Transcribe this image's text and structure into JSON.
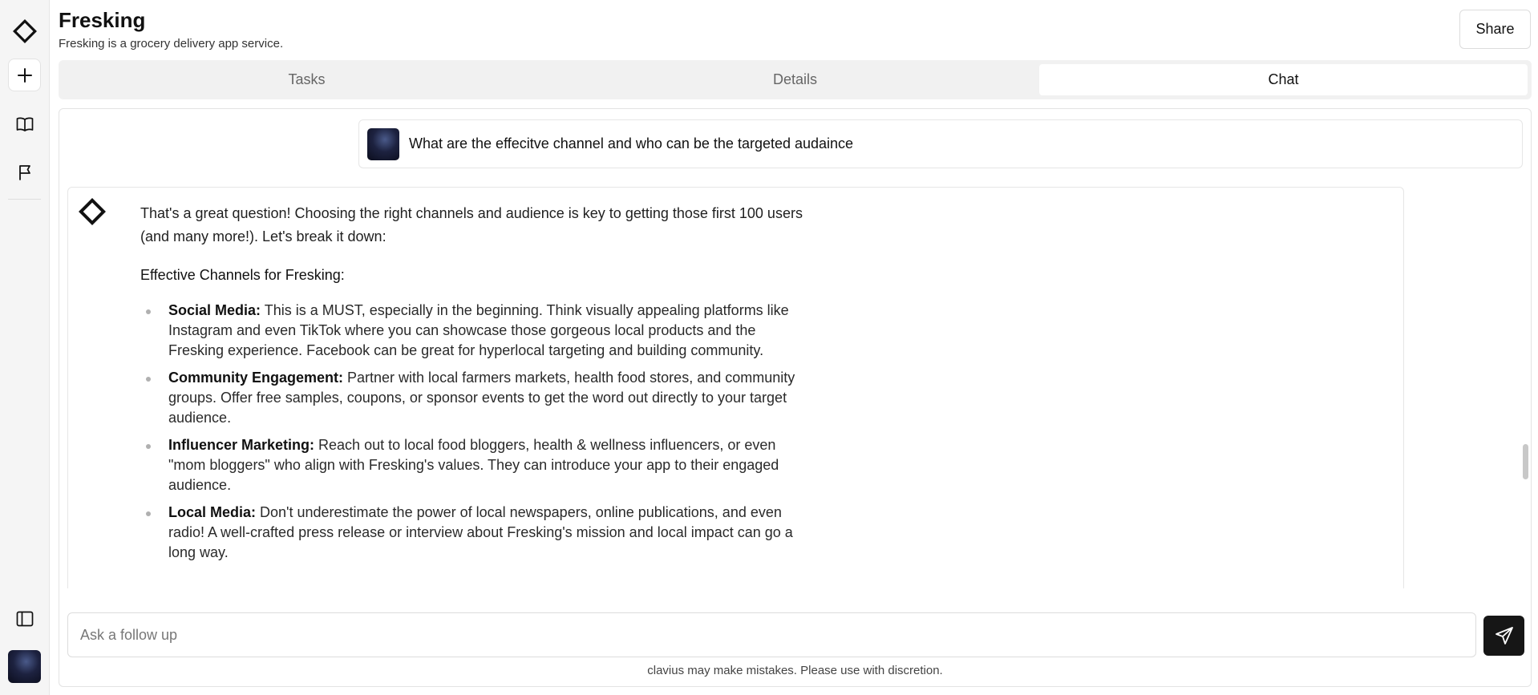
{
  "app": {
    "title": "Fresking",
    "subtitle": "Fresking is a grocery delivery app service.",
    "share_label": "Share"
  },
  "rail": {
    "icons": [
      "logo-diamond-icon",
      "plus-icon",
      "book-icon",
      "flag-icon",
      "sidebar-toggle-icon"
    ]
  },
  "tabs": [
    {
      "label": "Tasks",
      "active": false
    },
    {
      "label": "Details",
      "active": false
    },
    {
      "label": "Chat",
      "active": true
    }
  ],
  "chat": {
    "user_message": "What are the effecitve channel and who can be the targeted audaince",
    "bot": {
      "intro": "That's a great question! Choosing the right channels and audience is key to getting those first 100 users (and many more!). Let's break it down:",
      "heading": "Effective Channels for Fresking:",
      "items": [
        {
          "title": "Social Media:",
          "text": " This is a MUST, especially in the beginning. Think visually appealing platforms like Instagram and even TikTok where you can showcase those gorgeous local products and the Fresking experience. Facebook can be great for hyperlocal targeting and building community."
        },
        {
          "title": "Community Engagement:",
          "text": " Partner with local farmers markets, health food stores, and community groups. Offer free samples, coupons, or sponsor events to get the word out directly to your target audience."
        },
        {
          "title": "Influencer Marketing:",
          "text": " Reach out to local food bloggers, health & wellness influencers, or even \"mom bloggers\" who align with Fresking's values. They can introduce your app to their engaged audience."
        },
        {
          "title": "Local Media:",
          "text": " Don't underestimate the power of local newspapers, online publications, and even radio! A well-crafted press release or interview about Fresking's mission and local impact can go a long way."
        }
      ]
    }
  },
  "input": {
    "placeholder": "Ask a follow up",
    "value": ""
  },
  "disclaimer": "clavius may make mistakes. Please use with discretion."
}
